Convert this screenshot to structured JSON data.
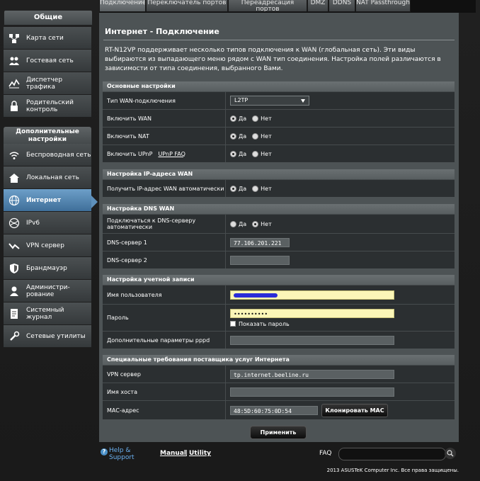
{
  "tabs": [
    "Подключение",
    "Переключатель портов",
    "Переадресация портов",
    "DMZ",
    "DDNS",
    "NAT Passthrough"
  ],
  "sidebar": {
    "general_title": "Общие",
    "general_items": [
      {
        "label": "Карта сети",
        "icon": "network-map-icon"
      },
      {
        "label": "Гостевая сеть",
        "icon": "guest-network-icon"
      },
      {
        "label": "Диспетчер трафика",
        "icon": "traffic-manager-icon"
      },
      {
        "label": "Родительский контроль",
        "icon": "parental-control-icon"
      }
    ],
    "advanced_title": "Дополнительные настройки",
    "advanced_items": [
      {
        "label": "Беспроводная сеть",
        "icon": "wireless-icon"
      },
      {
        "label": "Локальная сеть",
        "icon": "lan-icon"
      },
      {
        "label": "Интернет",
        "icon": "internet-icon",
        "active": true
      },
      {
        "label": "IPv6",
        "icon": "ipv6-icon"
      },
      {
        "label": "VPN сервер",
        "icon": "vpn-icon"
      },
      {
        "label": "Брандмауэр",
        "icon": "firewall-icon"
      },
      {
        "label": "Администри-рование",
        "icon": "admin-icon"
      },
      {
        "label": "Системный журнал",
        "icon": "system-log-icon"
      },
      {
        "label": "Сетевые утилиты",
        "icon": "network-tools-icon"
      }
    ]
  },
  "main": {
    "title": "Интернет - Подключение",
    "description": "RT-N12VP поддерживает несколько типов подключения к WAN (глобальная сеть). Эти виды выбираются из выпадающего меню рядом с WAN тип соединения. Настройка полей различаются в зависимости от типа соединения, выбранного Вами.",
    "yes": "Да",
    "no": "Нет",
    "basic": {
      "header": "Основные настройки",
      "wan_type_label": "Тип WAN-подключения",
      "wan_type_value": "L2TP",
      "enable_wan_label": "Включить WAN",
      "enable_nat_label": "Включить NAT",
      "enable_upnp_label": "Включить UPnP",
      "upnp_faq": "UPnP  FAQ"
    },
    "ip": {
      "header": "Настройка IP-адреса WAN",
      "auto_ip_label": "Получить IP-адрес WAN автоматически"
    },
    "dns": {
      "header": "Настройка DNS WAN",
      "auto_dns_label": "Подключаться к DNS-серверу автоматически",
      "dns1_label": "DNS-сервер 1",
      "dns1_value": "77.106.201.221",
      "dns2_label": "DNS-сервер 2",
      "dns2_value": ""
    },
    "account": {
      "header": "Настройка учетной записи",
      "username_label": "Имя пользователя",
      "password_label": "Пароль",
      "password_value": "••••••••••",
      "show_password": "Показать пароль",
      "pppd_label": "Дополнительные параметры pppd"
    },
    "isp": {
      "header": "Специальные требования поставщика услуг Интернета",
      "vpn_label": "VPN сервер",
      "vpn_value": "tp.internet.beeline.ru",
      "host_label": "Имя хоста",
      "mac_label": "MAC-адрес",
      "mac_value": "48:5D:60:75:0D:54",
      "clone_mac": "Клонировать MAC"
    },
    "apply": "Применить"
  },
  "footer": {
    "help": "Help & Support",
    "manual": "Manual",
    "sep": "|",
    "utility": "Utility",
    "faq": "FAQ",
    "copyright": "2013 ASUSTeK Computer Inc. Все права защищены."
  }
}
